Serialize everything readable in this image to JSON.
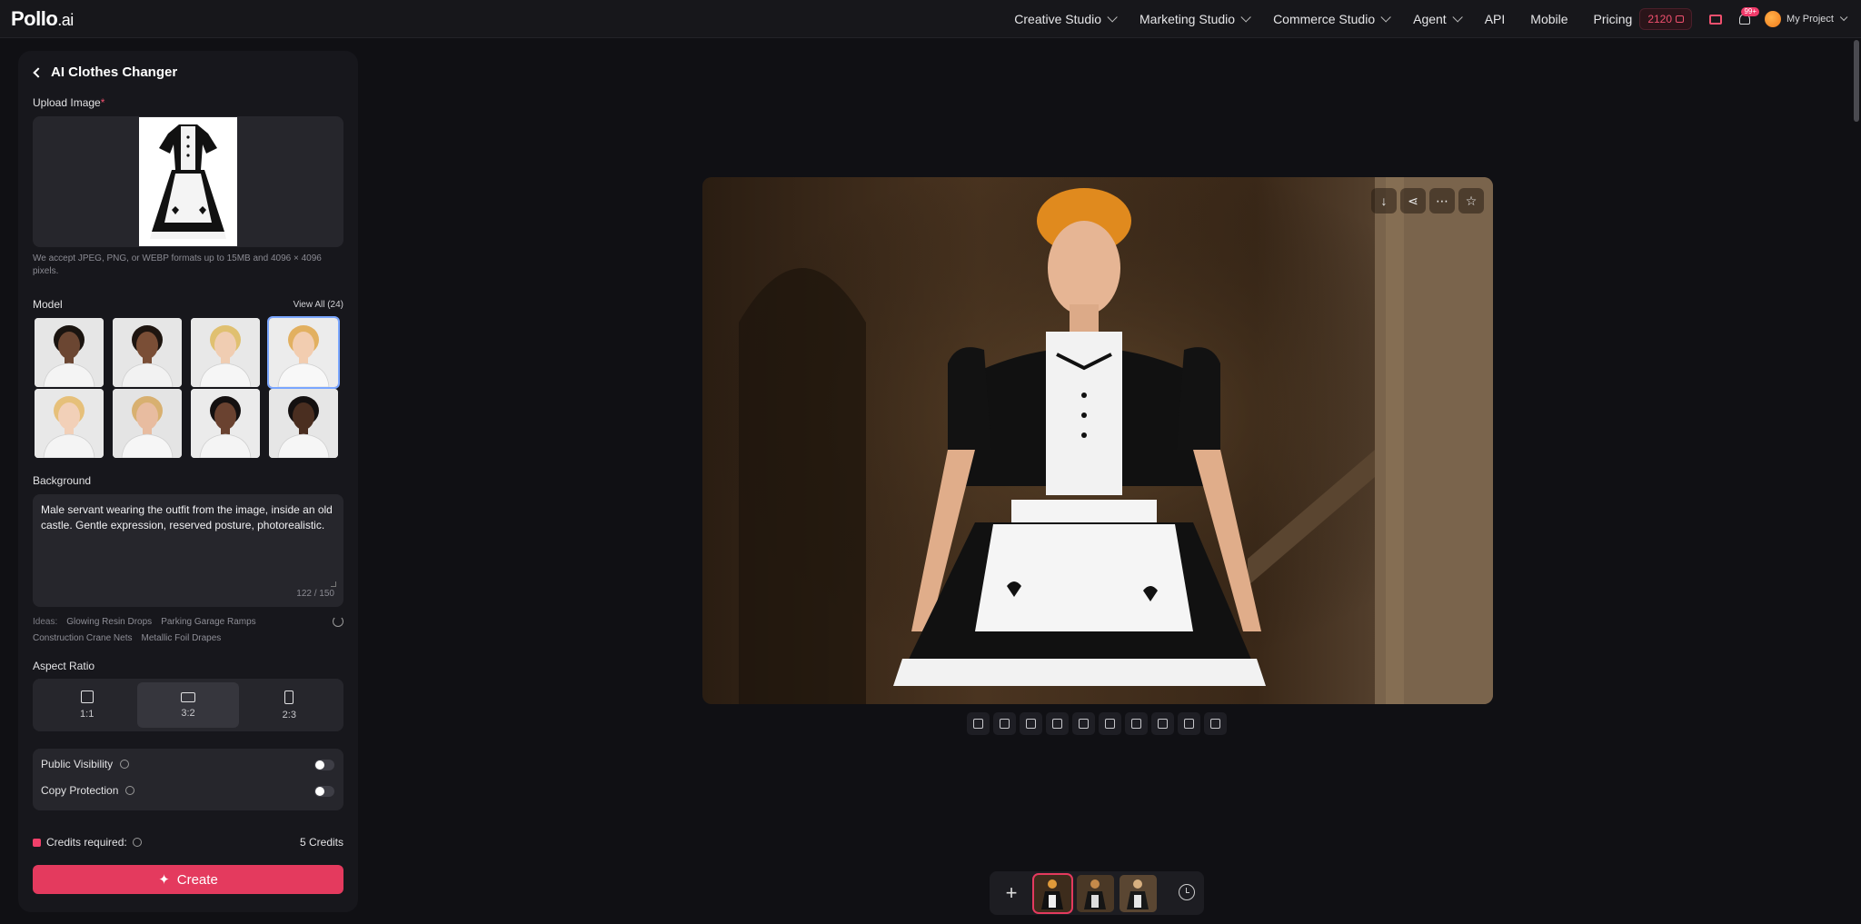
{
  "app": {
    "logo_main": "Pollo",
    "logo_suffix": ".ai"
  },
  "nav": {
    "items": [
      {
        "label": "Creative Studio",
        "dropdown": true
      },
      {
        "label": "Marketing Studio",
        "dropdown": true
      },
      {
        "label": "Commerce Studio",
        "dropdown": true
      },
      {
        "label": "Agent",
        "dropdown": true
      },
      {
        "label": "API",
        "dropdown": false
      },
      {
        "label": "Mobile",
        "dropdown": false
      },
      {
        "label": "Pricing",
        "dropdown": false
      }
    ],
    "credits": "2120",
    "notification_badge": "99+",
    "user_label": "My Project"
  },
  "panel": {
    "title": "AI Clothes Changer",
    "upload": {
      "label": "Upload Image",
      "required_mark": "*",
      "note": "We accept JPEG, PNG, or WEBP formats up to 15MB and 4096 × 4096 pixels."
    },
    "model": {
      "label": "Model",
      "view_all": "View All (24)",
      "selected_index": 3
    },
    "background": {
      "label": "Background",
      "value": "Male servant wearing the outfit from the image, inside an old castle. Gentle expression, reserved posture, photorealistic.",
      "counter": "122 / 150"
    },
    "ideas": {
      "label": "Ideas:",
      "items": [
        "Glowing Resin Drops",
        "Parking Garage Ramps",
        "Construction Crane Nets",
        "Metallic Foil Drapes"
      ]
    },
    "aspect": {
      "label": "Aspect Ratio",
      "options": [
        "1:1",
        "3:2",
        "2:3"
      ],
      "selected": "3:2"
    },
    "toggles": {
      "public_visibility": "Public Visibility",
      "copy_protection": "Copy Protection"
    },
    "credits_required_label": "Credits required:",
    "credits_required_value": "5 Credits",
    "create_label": "Create"
  },
  "colors": {
    "accent": "#e43a5e",
    "panel_bg": "#17171c",
    "page_bg": "#101014"
  }
}
